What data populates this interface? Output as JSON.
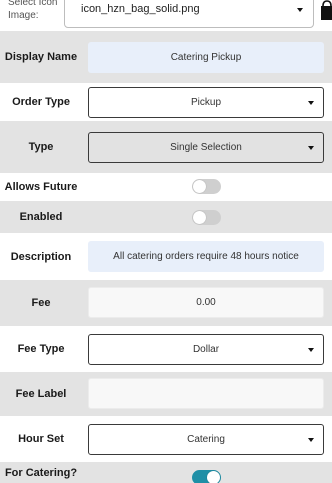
{
  "icon_picker": {
    "label": "Select Icon Image:",
    "value": "icon_hzn_bag_solid.png",
    "preview_icon": "bag-icon"
  },
  "form": {
    "display_name": {
      "label": "Display Name",
      "value": "Catering Pickup"
    },
    "order_type": {
      "label": "Order Type",
      "value": "Pickup"
    },
    "type": {
      "label": "Type",
      "value": "Single Selection"
    },
    "allows_future": {
      "label": "Allows Future",
      "on": false
    },
    "enabled": {
      "label": "Enabled",
      "on": false
    },
    "description": {
      "label": "Description",
      "value": "All catering orders require 48 hours notice"
    },
    "fee": {
      "label": "Fee",
      "value": "0.00"
    },
    "fee_type": {
      "label": "Fee Type",
      "value": "Dollar"
    },
    "fee_label": {
      "label": "Fee Label",
      "value": ""
    },
    "hour_set": {
      "label": "Hour Set",
      "value": "Catering"
    },
    "for_catering": {
      "label": "For Catering?",
      "on": true
    }
  },
  "colors": {
    "row_shade": "#e3e3e3",
    "input_blue": "#e8effa",
    "toggle_on": "#1f8fa6",
    "toggle_off": "#cfcfcf"
  }
}
